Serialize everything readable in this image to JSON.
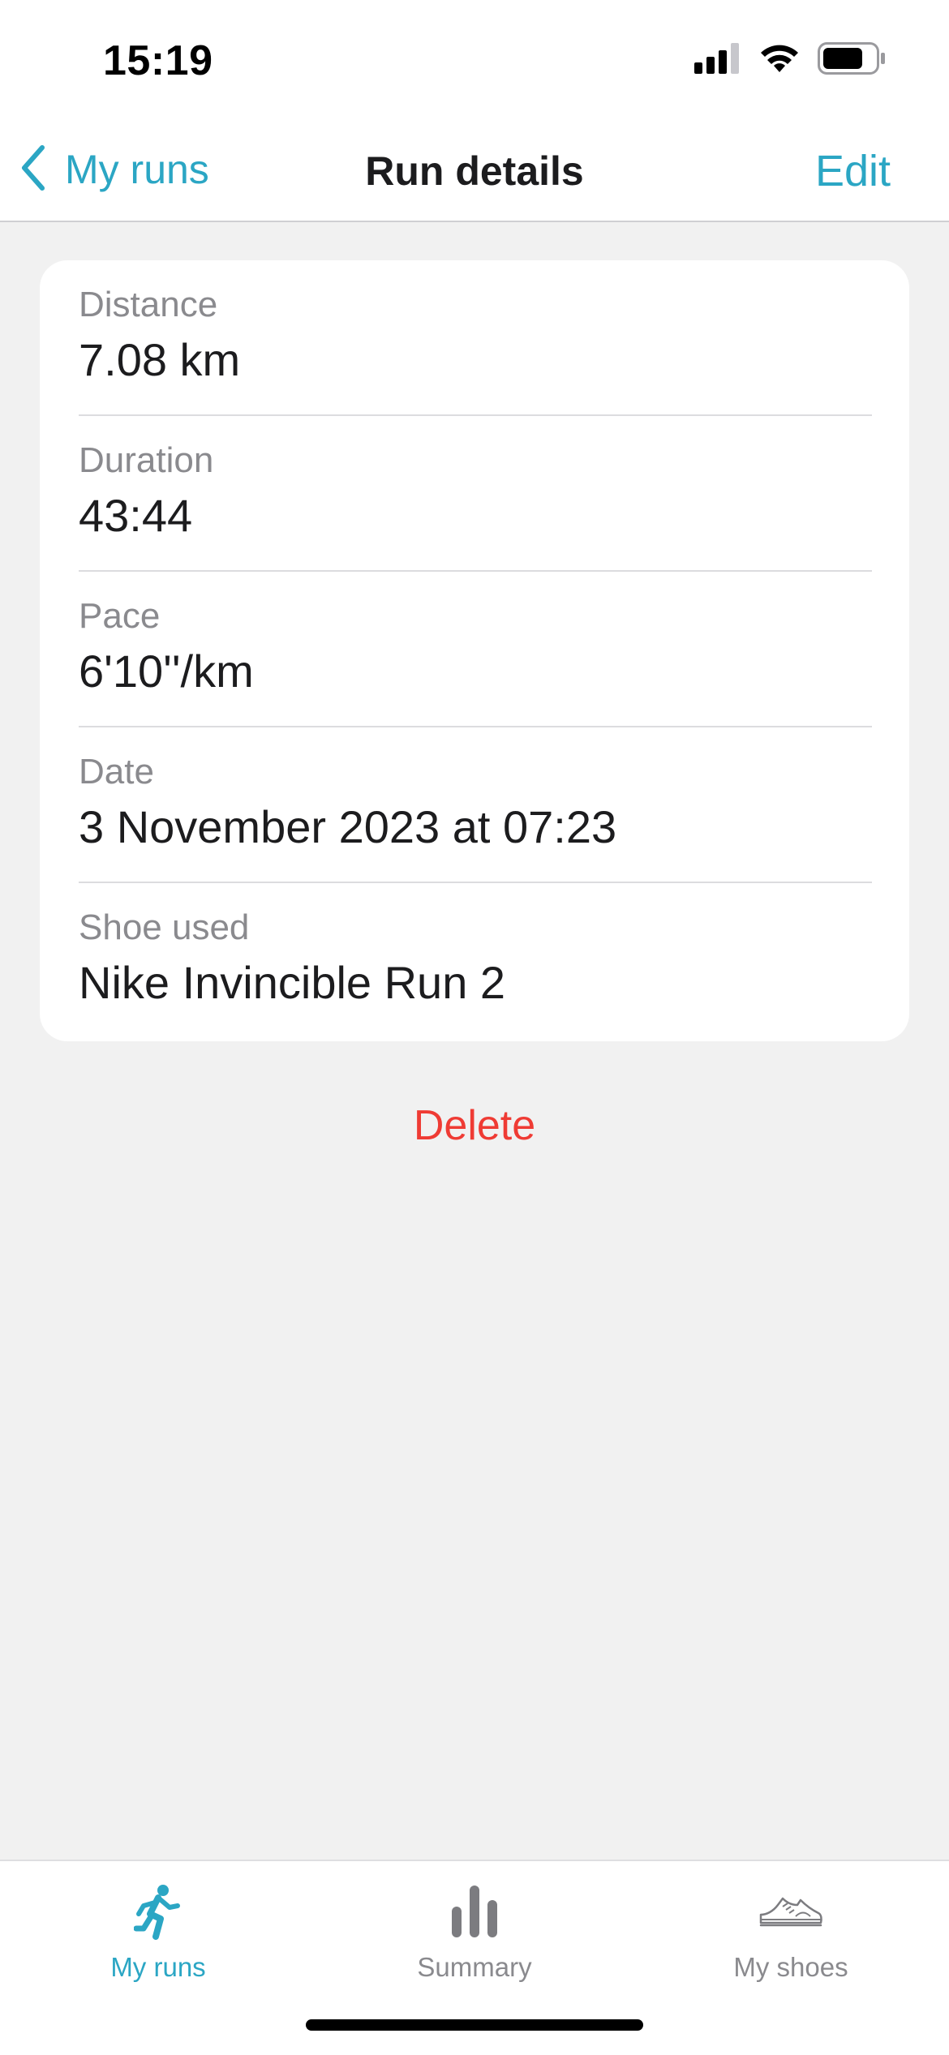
{
  "status_bar": {
    "time": "15:19",
    "icons": [
      "cellular-signal-icon",
      "wifi-icon",
      "battery-icon"
    ]
  },
  "nav": {
    "back_label": "My runs",
    "title": "Run details",
    "edit_label": "Edit"
  },
  "details": [
    {
      "label": "Distance",
      "value": "7.08 km"
    },
    {
      "label": "Duration",
      "value": "43:44"
    },
    {
      "label": "Pace",
      "value": "6'10''/km"
    },
    {
      "label": "Date",
      "value": "3 November 2023 at 07:23"
    },
    {
      "label": "Shoe used",
      "value": "Nike Invincible Run 2"
    }
  ],
  "delete_label": "Delete",
  "tabs": [
    {
      "label": "My runs",
      "icon": "runner-icon",
      "active": true
    },
    {
      "label": "Summary",
      "icon": "bar-chart-icon",
      "active": false
    },
    {
      "label": "My shoes",
      "icon": "sneaker-icon",
      "active": false
    }
  ],
  "colors": {
    "accent": "#2ba6c4",
    "destructive": "#ef3b34",
    "background": "#f1f1f1",
    "secondary_text": "#8a8a8e"
  }
}
